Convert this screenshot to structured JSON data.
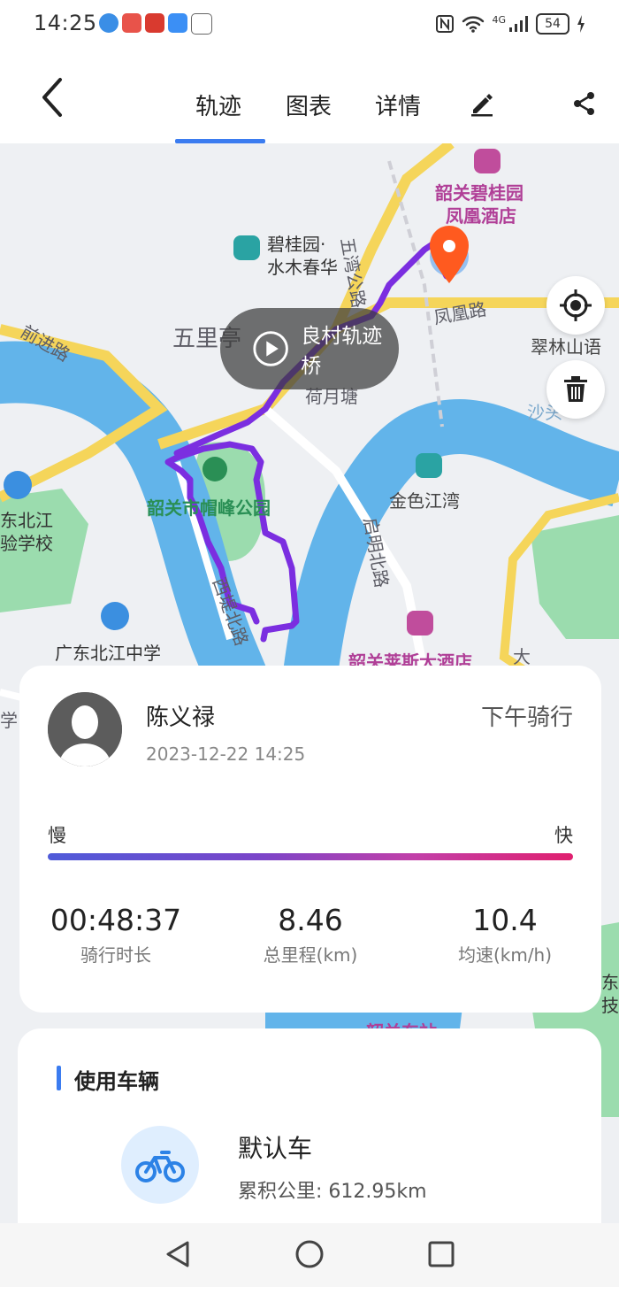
{
  "status_bar": {
    "time": "14:25",
    "app_icons": [
      "compass-app-icon",
      "huawei-app-icon",
      "gift-app-icon",
      "weather-app-icon",
      "ride-life-app-icon"
    ],
    "network": "4G",
    "battery": "54"
  },
  "header": {
    "back_icon": "chevron-left-icon",
    "tabs": [
      {
        "label": "轨迹",
        "active": true
      },
      {
        "label": "图表",
        "active": false
      },
      {
        "label": "详情",
        "active": false
      }
    ],
    "edit_icon": "pencil-icon",
    "share_icon": "share-icon",
    "accent_color": "#3b7cf0"
  },
  "map": {
    "labels": {
      "poi_1": "韶关碧桂园",
      "poi_1b": "凤凰酒店",
      "poi_2a": "碧桂园·",
      "poi_2b": "水木春华",
      "road_wuwan": "五湾公路",
      "road_fenghuang": "凤凰路",
      "cuilin": "翠林山语",
      "wuliting": "五里亭",
      "road_qianjin": "前进路",
      "heyuetang": "荷月塘",
      "shasha": "沙头",
      "park": "韶关市帽峰公园",
      "jinse": "金色江湾",
      "road_qiming": "启明北路",
      "road_xiti": "西堤北路",
      "school_1a": "东北江",
      "school_1b": "验学校",
      "school_2": "广东北江中学",
      "poi_3": "韶关莱斯大酒店",
      "da": "大",
      "xue": "学",
      "dong": "东",
      "ji": "技",
      "station": "韶关东站"
    },
    "route_color": "#7b2ee0",
    "locate_icon": "crosshair-icon",
    "delete_icon": "trash-icon",
    "playback_label": "良村轨迹桥",
    "play_icon": "play-icon"
  },
  "ride": {
    "user_name": "陈义禄",
    "date": "2023-12-22 14:25",
    "ride_type": "下午骑行",
    "slow_label": "慢",
    "fast_label": "快",
    "stats": [
      {
        "value": "00:48:37",
        "label": "骑行时长"
      },
      {
        "value": "8.46",
        "label": "总里程(km)"
      },
      {
        "value": "10.4",
        "label": "均速(km/h)"
      }
    ]
  },
  "vehicle": {
    "section_title": "使用车辆",
    "bike_icon": "bicycle-icon",
    "name": "默认车",
    "mileage": "累积公里: 612.95km"
  },
  "nav_bar": {
    "back": "triangle-back-icon",
    "home": "circle-home-icon",
    "recents": "square-recents-icon"
  }
}
